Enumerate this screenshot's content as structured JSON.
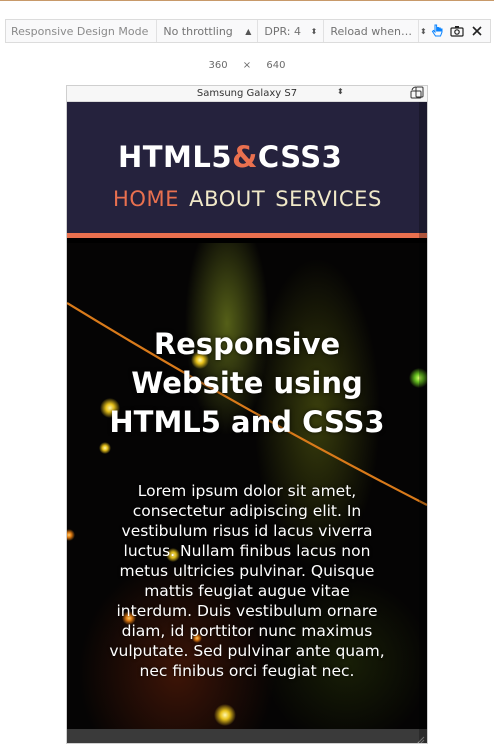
{
  "toolbar": {
    "title": "Responsive Design Mode",
    "throttling": "No throttling",
    "dpr": "DPR: 4",
    "reload": "Reload when…"
  },
  "size": {
    "width": "360",
    "separator": "×",
    "height": "640"
  },
  "device": {
    "name": "Samsung Galaxy S7"
  },
  "site": {
    "logo_part1": "HTML5",
    "logo_amp": "&",
    "logo_part2": "CSS3",
    "nav": [
      "HOME",
      "ABOUT",
      "SERVICES"
    ],
    "hero_title": "Responsive Website using HTML5 and CSS3",
    "hero_text": "Lorem ipsum dolor sit amet, consectetur adipiscing elit. In vestibulum risus id lacus viverra luctus. Nullam finibus lacus non metus ultricies pulvinar. Quisque mattis feugiat augue vitae interdum. Duis vestibulum ornare diam, id porttitor nunc maximus vulputate. Sed pulvinar ante quam, nec finibus orci feugiat nec."
  },
  "colors": {
    "accent": "#e9704f",
    "header_bg": "#25223d",
    "nav_text": "#f0e8c8"
  }
}
